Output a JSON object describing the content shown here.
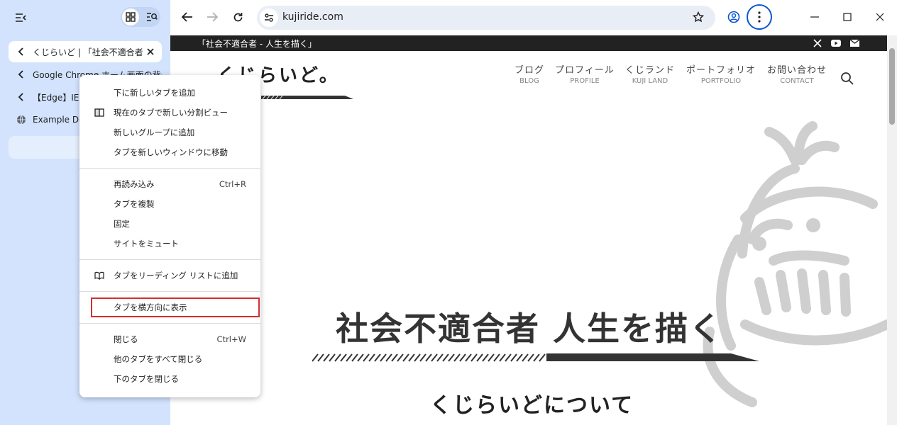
{
  "sidebar": {
    "tabs": [
      {
        "label": "くじらいど | 「社会不適合者 - 人生を描く」",
        "icon": "back-arrow-icon",
        "active": true
      },
      {
        "label": "Google Chrome ホーム画面の背景",
        "icon": "back-arrow-icon",
        "active": false
      },
      {
        "label": "【Edge】IEモード",
        "icon": "back-arrow-icon",
        "active": false
      },
      {
        "label": "Example Domain",
        "icon": "globe-icon",
        "active": false
      }
    ]
  },
  "toolbar": {
    "url": "kujiride.com"
  },
  "page": {
    "topbar_text": "「社会不適合者 - 人生を描く」",
    "logo_text": "くじらいど。",
    "nav": [
      {
        "jp": "ブログ",
        "en": "BLOG"
      },
      {
        "jp": "プロフィール",
        "en": "PROFILE"
      },
      {
        "jp": "くじランド",
        "en": "KUJI LAND"
      },
      {
        "jp": "ポートフォリオ",
        "en": "PORTFOLIO"
      },
      {
        "jp": "お問い合わせ",
        "en": "CONTACT"
      }
    ],
    "hero_title": "社会不適合者 人生を描く",
    "hero_sub": "くじらいどについて"
  },
  "menu": {
    "groups": [
      [
        {
          "label": "下に新しいタブを追加",
          "shortcut": "",
          "icon": ""
        },
        {
          "label": "現在のタブで新しい分割ビュー",
          "shortcut": "",
          "icon": "split-view-icon"
        },
        {
          "label": "新しいグループに追加",
          "shortcut": "",
          "icon": ""
        },
        {
          "label": "タブを新しいウィンドウに移動",
          "shortcut": "",
          "icon": ""
        }
      ],
      [
        {
          "label": "再読み込み",
          "shortcut": "Ctrl+R",
          "icon": ""
        },
        {
          "label": "タブを複製",
          "shortcut": "",
          "icon": ""
        },
        {
          "label": "固定",
          "shortcut": "",
          "icon": ""
        },
        {
          "label": "サイトをミュート",
          "shortcut": "",
          "icon": ""
        }
      ],
      [
        {
          "label": "タブをリーディング リストに追加",
          "shortcut": "",
          "icon": "reading-list-icon"
        }
      ],
      [
        {
          "label": "タブを横方向に表示",
          "shortcut": "",
          "icon": "",
          "highlighted": true
        }
      ],
      [
        {
          "label": "閉じる",
          "shortcut": "Ctrl+W",
          "icon": ""
        },
        {
          "label": "他のタブをすべて閉じる",
          "shortcut": "",
          "icon": ""
        },
        {
          "label": "下のタブを閉じる",
          "shortcut": "",
          "icon": ""
        }
      ]
    ]
  },
  "colors": {
    "sidebar_bg": "#d3e3fd",
    "highlight": "#d32f2f",
    "accent": "#0b57d0"
  }
}
